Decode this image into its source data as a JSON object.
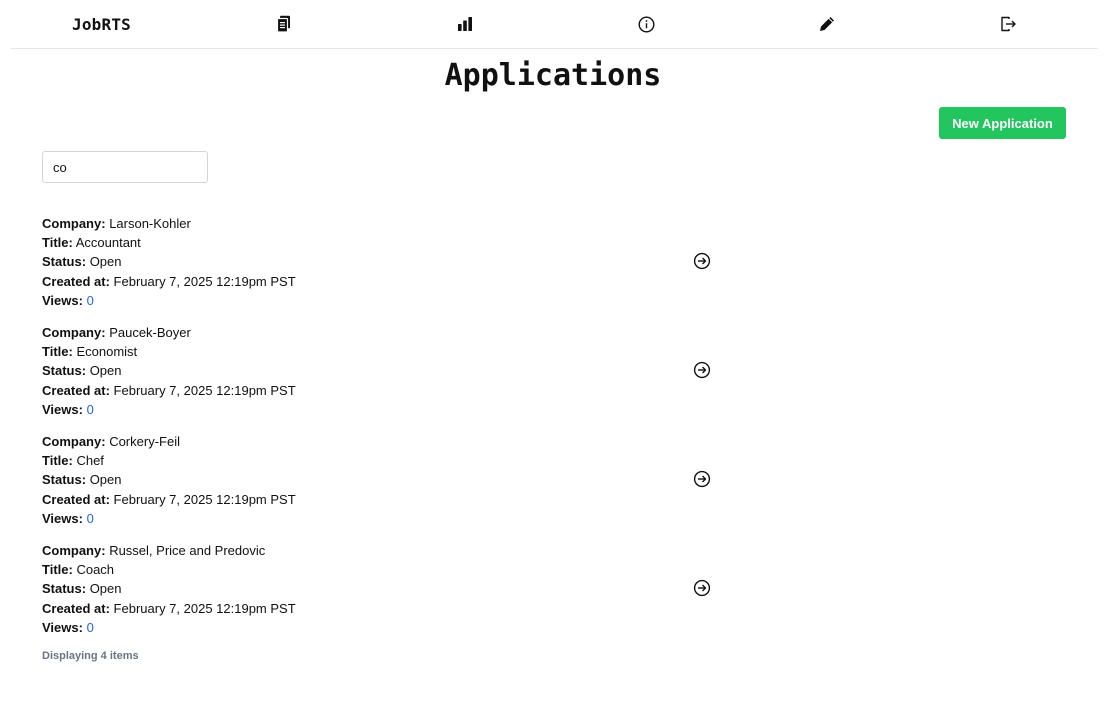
{
  "nav": {
    "brand": "JobRTS",
    "icons": [
      "applications-icon",
      "stats-icon",
      "info-icon",
      "edit-icon",
      "logout-icon"
    ]
  },
  "page": {
    "title": "Applications",
    "new_button_label": "New Application"
  },
  "search": {
    "value": "co"
  },
  "labels": {
    "company": "Company:",
    "title": "Title:",
    "status": "Status:",
    "created_at": "Created at:",
    "views": "Views:"
  },
  "applications": [
    {
      "company": "Larson-Kohler",
      "title": "Accountant",
      "status": "Open",
      "created_at": "February 7, 2025 12:19pm PST",
      "views": "0"
    },
    {
      "company": "Paucek-Boyer",
      "title": "Economist",
      "status": "Open",
      "created_at": "February 7, 2025 12:19pm PST",
      "views": "0"
    },
    {
      "company": "Corkery-Feil",
      "title": "Chef",
      "status": "Open",
      "created_at": "February 7, 2025 12:19pm PST",
      "views": "0"
    },
    {
      "company": "Russel, Price and Predovic",
      "title": "Coach",
      "status": "Open",
      "created_at": "February 7, 2025 12:19pm PST",
      "views": "0"
    }
  ],
  "footer": {
    "text": "Displaying 4 items"
  },
  "colors": {
    "accent": "#22c55e",
    "link": "#2563eb",
    "muted": "#6b7280"
  }
}
